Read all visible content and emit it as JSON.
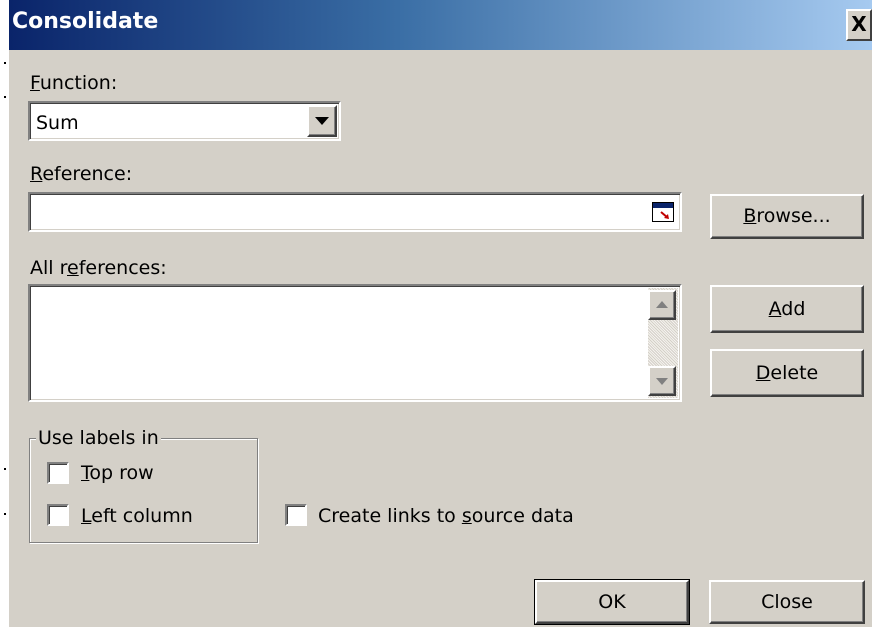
{
  "window": {
    "title": "Consolidate",
    "close_glyph": "X"
  },
  "function": {
    "label_accel": "F",
    "label_rest": "unction:",
    "selected": "Sum"
  },
  "reference": {
    "label_accel": "R",
    "label_rest": "eference:",
    "value": ""
  },
  "all_references": {
    "label_pre": "All r",
    "label_accel": "e",
    "label_rest": "ferences:"
  },
  "buttons": {
    "browse": {
      "accel": "B",
      "rest": "rowse..."
    },
    "add": {
      "accel": "A",
      "rest": "dd"
    },
    "delete": {
      "accel": "D",
      "rest": "elete"
    },
    "ok": "OK",
    "close": "Close"
  },
  "use_labels": {
    "title": "Use labels in",
    "top_row": {
      "accel": "T",
      "rest": "op row",
      "checked": false
    },
    "left_column": {
      "accel": "L",
      "rest": "eft column",
      "checked": false
    }
  },
  "create_links": {
    "pre": "Create links to ",
    "accel": "s",
    "rest": "ource data",
    "checked": false
  },
  "icons": {
    "collapse": "collapse-dialog-icon",
    "dropdown": "chevron-down-icon"
  }
}
